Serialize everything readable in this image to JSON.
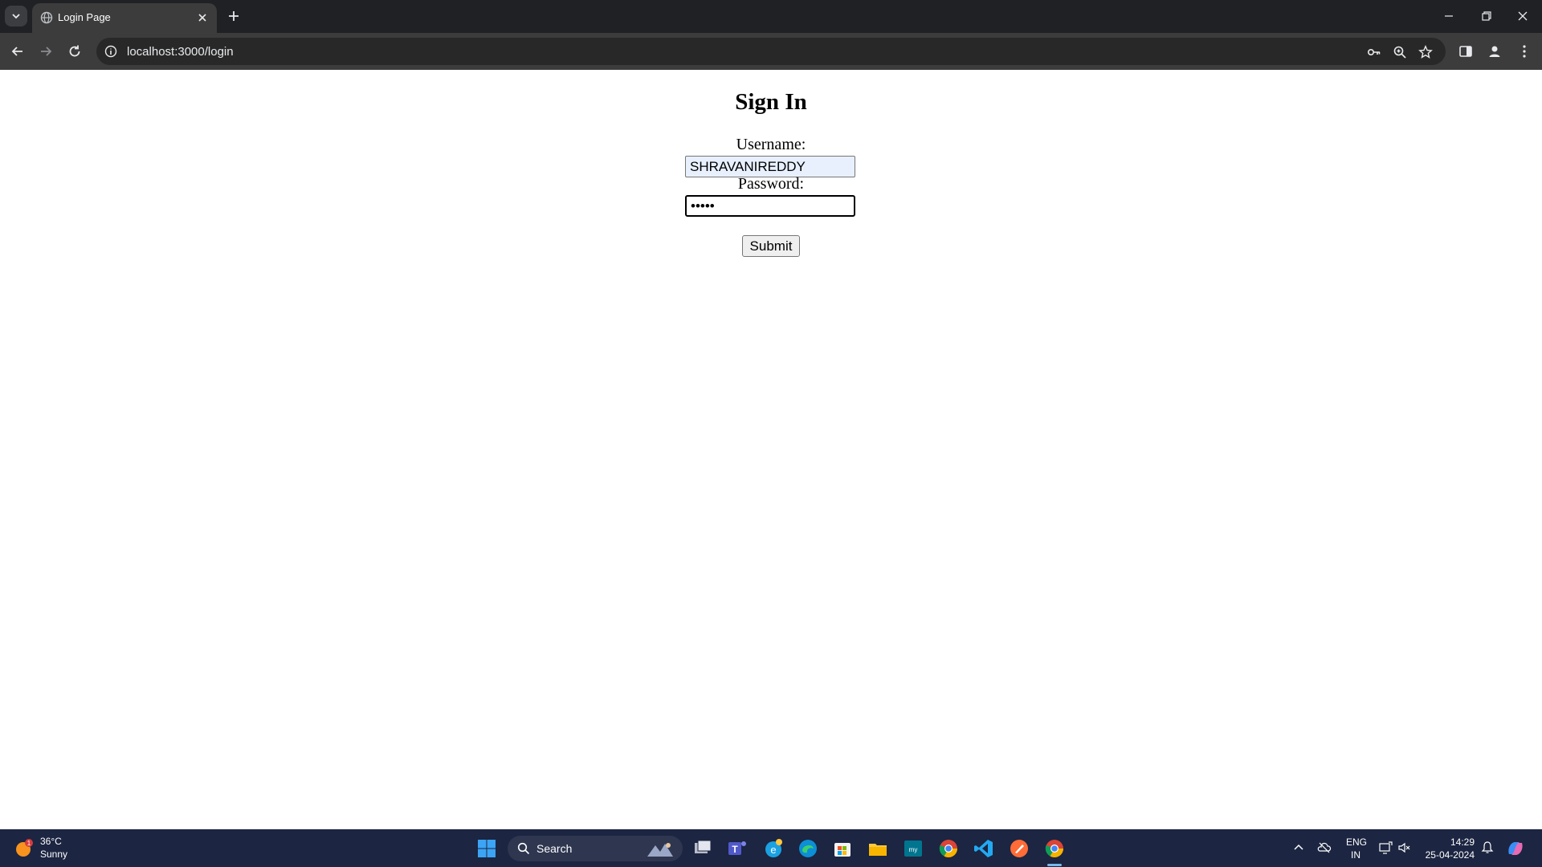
{
  "browser": {
    "tab_title": "Login Page",
    "url": "localhost:3000/login"
  },
  "page": {
    "heading": "Sign In",
    "username_label": "Username:",
    "username_value": "SHRAVANIREDDY",
    "password_label": "Password:",
    "password_value": "•••••",
    "submit_label": "Submit"
  },
  "taskbar": {
    "weather_temp": "36°C",
    "weather_desc": "Sunny",
    "weather_badge": "1",
    "search_placeholder": "Search",
    "lang_line1": "ENG",
    "lang_line2": "IN",
    "time": "14:29",
    "date": "25-04-2024"
  },
  "colors": {
    "tabbar_bg": "#202124",
    "toolbar_bg": "#3c3c3c",
    "taskbar_bg": "#1c2541",
    "autofill_bg": "#e8f0fe"
  }
}
